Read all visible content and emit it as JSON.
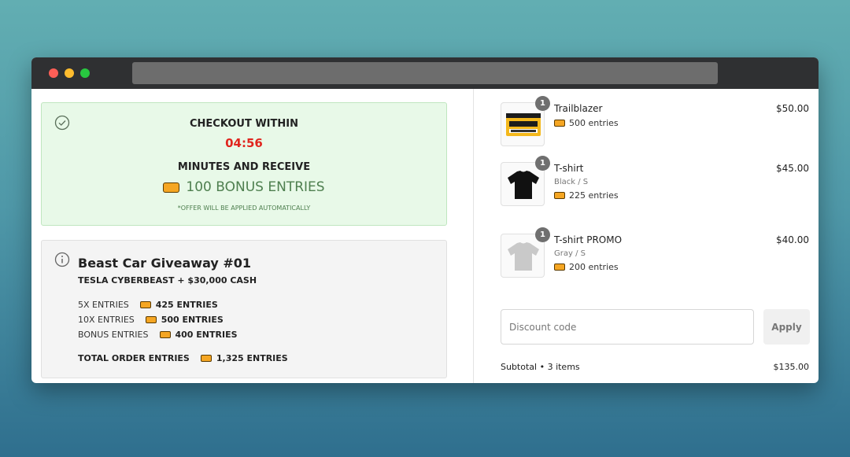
{
  "promo": {
    "line1": "CHECKOUT WITHIN",
    "timer": "04:56",
    "line2": "MINUTES AND RECEIVE",
    "bonus": "100 BONUS ENTRIES",
    "note": "*OFFER WILL BE APPLIED AUTOMATICALLY",
    "icon": "check-circle-icon"
  },
  "giveaway": {
    "icon": "info-circle-icon",
    "title": "Beast Car Giveaway #01",
    "subtitle": "TESLA CYBERBEAST + $30,000 CASH",
    "rows": [
      {
        "label": "5X ENTRIES",
        "value": "425 ENTRIES"
      },
      {
        "label": "10X ENTRIES",
        "value": "500 ENTRIES"
      },
      {
        "label": "BONUS ENTRIES",
        "value": "400 ENTRIES"
      }
    ],
    "total": {
      "label": "TOTAL ORDER ENTRIES",
      "value": "1,325 ENTRIES"
    }
  },
  "cart": {
    "items": [
      {
        "name": "Trailblazer",
        "variant": "",
        "entries": "500 entries",
        "price": "$50.00",
        "qty": "1"
      },
      {
        "name": "T-shirt",
        "variant": "Black / S",
        "entries": "225 entries",
        "price": "$45.00",
        "qty": "1"
      },
      {
        "name": "T-shirt PROMO",
        "variant": "Gray / S",
        "entries": "200 entries",
        "price": "$40.00",
        "qty": "1"
      }
    ],
    "discount_placeholder": "Discount code",
    "apply_label": "Apply",
    "subtotal_label": "Subtotal • 3 items",
    "subtotal_value": "$135.00"
  },
  "colors": {
    "timer": "#e0261f",
    "promo_bg": "#e8f9e8",
    "ticket": "#f5a623"
  }
}
